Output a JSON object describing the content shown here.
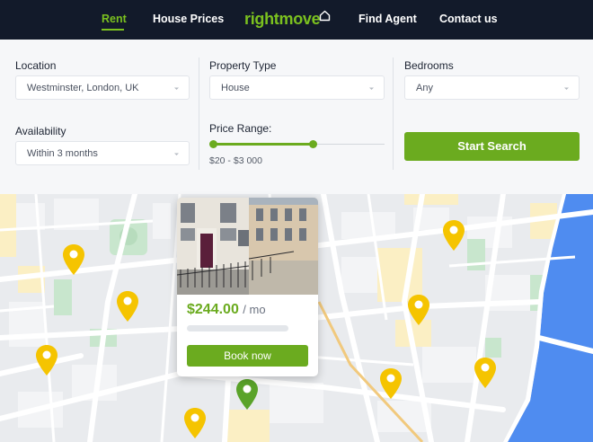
{
  "nav": {
    "items": [
      {
        "label": "Rent",
        "active": true
      },
      {
        "label": "House Prices",
        "active": false
      },
      {
        "label": "Find Agent",
        "active": false
      },
      {
        "label": "Contact us",
        "active": false
      }
    ],
    "logo": "rightmove"
  },
  "search": {
    "location": {
      "label": "Location",
      "value": "Westminster, London, UK"
    },
    "property_type": {
      "label": "Property Type",
      "value": "House"
    },
    "bedrooms": {
      "label": "Bedrooms",
      "value": "Any"
    },
    "availability": {
      "label": "Availability",
      "value": "Within 3 months"
    },
    "price_range": {
      "label": "Price Range:",
      "value_text": "$20 - $3 000",
      "min_fraction": 0.0,
      "max_fraction": 0.58
    },
    "start_button": "Start Search"
  },
  "card": {
    "price": "$244.00",
    "unit": "/ mo",
    "book_button": "Book now"
  },
  "colors": {
    "accent": "#6bab1f",
    "nav_bg": "#121a2a",
    "pin_yellow": "#f5c400",
    "pin_green": "#5aa32a",
    "water": "#4f8cf0"
  }
}
